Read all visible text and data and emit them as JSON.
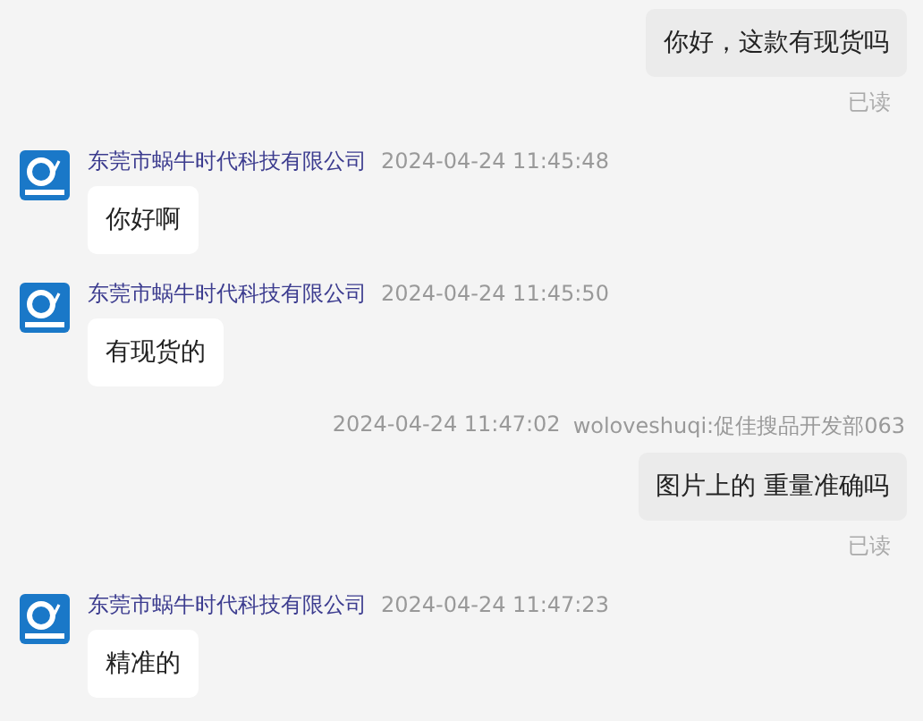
{
  "messages": [
    {
      "kind": "outgoing",
      "text": "你好，这款有现货吗",
      "status": "已读"
    },
    {
      "kind": "incoming",
      "sender": "东莞市蜗牛时代科技有限公司",
      "time": "2024-04-24 11:45:48",
      "text": "你好啊"
    },
    {
      "kind": "incoming",
      "sender": "东莞市蜗牛时代科技有限公司",
      "time": "2024-04-24 11:45:50",
      "text": "有现货的"
    },
    {
      "kind": "outgoing",
      "time": "2024-04-24 11:47:02",
      "sender": "woloveshuqi:促佳搜品开发部063",
      "text": "图片上的 重量准确吗",
      "status": "已读"
    },
    {
      "kind": "incoming",
      "sender": "东莞市蜗牛时代科技有限公司",
      "time": "2024-04-24 11:47:23",
      "text": "精准的"
    }
  ]
}
